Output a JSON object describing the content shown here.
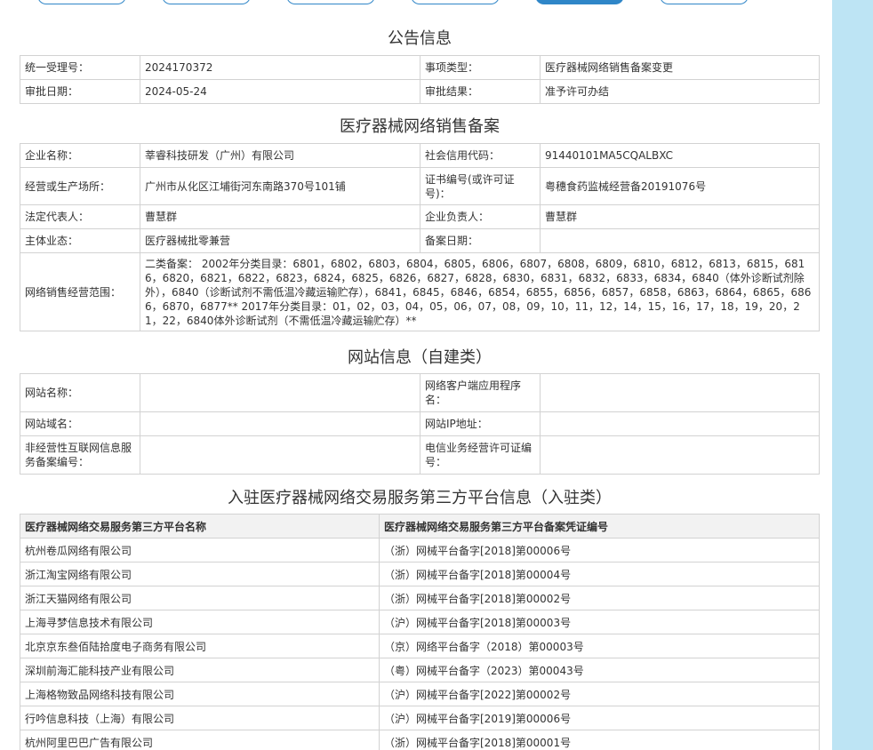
{
  "sections": {
    "announcement": "公告信息",
    "filing": "医疗器械网络销售备案",
    "website": "网站信息（自建类）",
    "platform": "入驻医疗器械网络交易服务第三方平台信息（入驻类）"
  },
  "announcement": {
    "acceptance_no_label": "统一受理号：",
    "acceptance_no": "2024170372",
    "item_type_label": "事项类型：",
    "item_type": "医疗器械网络销售备案变更",
    "approval_date_label": "审批日期：",
    "approval_date": "2024-05-24",
    "approval_result_label": "审批结果：",
    "approval_result": "准予许可办结"
  },
  "filing": {
    "company_name_label": "企业名称：",
    "company_name": "莘睿科技研发（广州）有限公司",
    "credit_code_label": "社会信用代码：",
    "credit_code": "91440101MA5CQALBXC",
    "address_label": "经营或生产场所：",
    "address": "广州市从化区江埔街河东南路370号101铺",
    "cert_no_label": "证书编号(或许可证号)：",
    "cert_no": "粤穗食药监械经营备20191076号",
    "legal_rep_label": "法定代表人：",
    "legal_rep": "曹慧群",
    "person_in_charge_label": "企业负责人：",
    "person_in_charge": "曹慧群",
    "business_type_label": "主体业态：",
    "business_type": "医疗器械批零兼营",
    "filing_date_label": "备案日期：",
    "filing_date": "",
    "scope_label": "网络销售经营范围：",
    "scope": "二类备案： 2002年分类目录：6801，6802，6803，6804，6805，6806，6807，6808，6809，6810，6812，6813，6815，6816，6820，6821，6822，6823，6824，6825，6826，6827，6828，6830，6831，6832，6833，6834，6840（体外诊断试剂除外），6840（诊断试剂不需低温冷藏运输贮存），6841，6845，6846，6854，6855，6856，6857，6858，6863，6864，6865，6866，6870，6877** 2017年分类目录：01，02，03，04，05，06，07，08，09，10，11，12，14，15，16，17，18，19，20，21，22，6840体外诊断试剂（不需低温冷藏运输贮存）**"
  },
  "website": {
    "site_name_label": "网站名称：",
    "site_name": "",
    "app_name_label": "网络客户端应用程序名：",
    "app_name": "",
    "domain_label": "网站域名：",
    "domain": "",
    "ip_label": "网站IP地址：",
    "ip": "",
    "icp_label": "非经营性互联网信息服务备案编号：",
    "icp": "",
    "telecom_label": "电信业务经营许可证编号：",
    "telecom": ""
  },
  "platform": {
    "headers": [
      "医疗器械网络交易服务第三方平台名称",
      "医疗器械网络交易服务第三方平台备案凭证编号"
    ],
    "rows": [
      [
        "杭州卷瓜网络有限公司",
        "（浙）网械平台备字[2018]第00006号"
      ],
      [
        "浙江淘宝网络有限公司",
        "（浙）网械平台备字[2018]第00004号"
      ],
      [
        "浙江天猫网络有限公司",
        "（浙）网械平台备字[2018]第00002号"
      ],
      [
        "上海寻梦信息技术有限公司",
        "（沪）网械平台备字[2018]第00003号"
      ],
      [
        "北京京东叁佰陆拾度电子商务有限公司",
        "（京）网络平台备字（2018）第00003号"
      ],
      [
        "深圳前海汇能科技产业有限公司",
        "（粤）网械平台备字（2023）第00043号"
      ],
      [
        "上海格物致品网络科技有限公司",
        "（沪）网械平台备字[2022]第00002号"
      ],
      [
        "行吟信息科技（上海）有限公司",
        "（沪）网械平台备字[2019]第00006号"
      ],
      [
        "杭州阿里巴巴广告有限公司",
        "（浙）网械平台备字[2018]第00001号"
      ]
    ]
  },
  "colors": {
    "tab_border": "#2f86c8",
    "right_strip": "#bde4f4",
    "grid": "#d2d2d2",
    "header_bg": "#f2f2f2"
  }
}
